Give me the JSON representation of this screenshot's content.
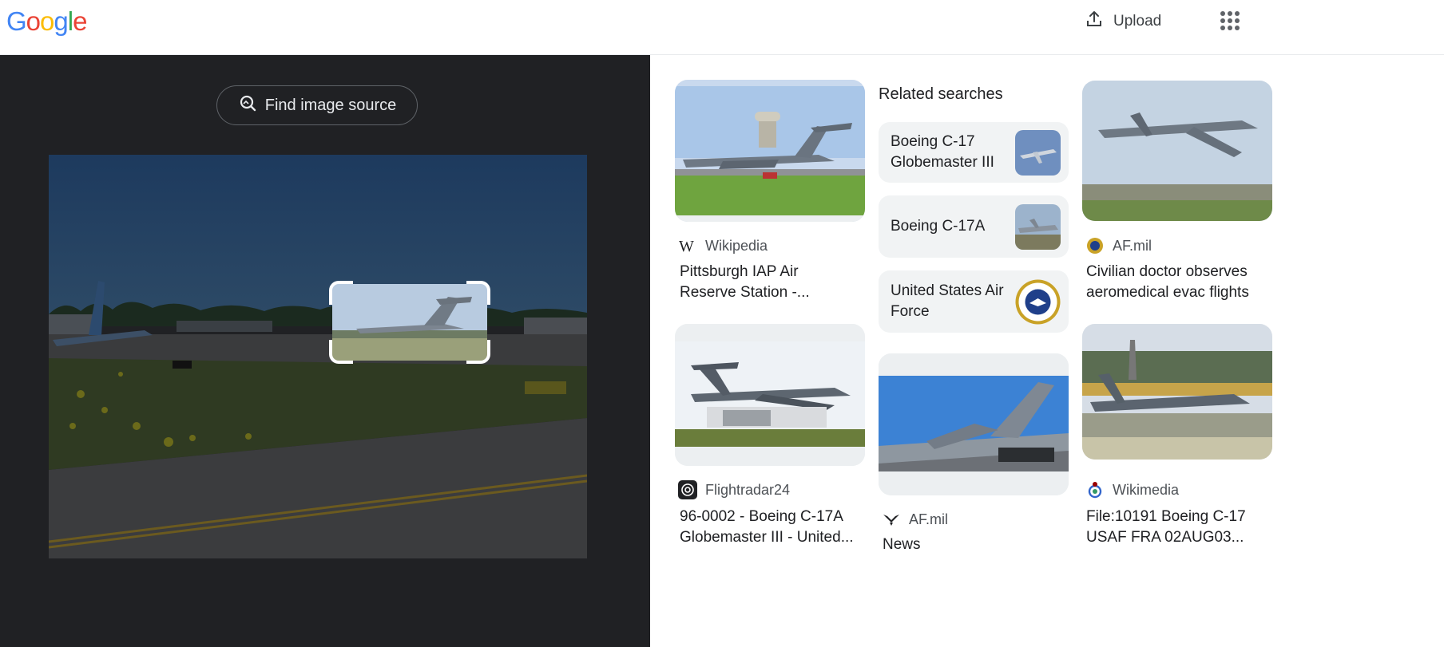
{
  "header": {
    "logo_letters": [
      "G",
      "o",
      "o",
      "g",
      "l",
      "e"
    ],
    "logo_colors": [
      "#4285F4",
      "#EA4335",
      "#FBBC05",
      "#4285F4",
      "#34A853",
      "#EA4335"
    ],
    "upload_label": "Upload",
    "upload_icon": "upload-icon",
    "apps_icon": "apps-grid-icon"
  },
  "lens": {
    "find_source_label": "Find image source",
    "find_source_icon": "image-search-icon"
  },
  "results": {
    "cards": [
      {
        "source": "Wikipedia",
        "source_icon": "wikipedia-icon",
        "title_line1": "Pittsburgh IAP Air",
        "title_line2": "Reserve Station -..."
      },
      {
        "source": "Flightradar24",
        "source_icon": "flightradar24-icon",
        "title_line1": "96-0002 - Boeing C-17A",
        "title_line2": "Globemaster III - United..."
      },
      {
        "source": "AF.mil",
        "source_icon": "af-mil-wings-icon",
        "title_line1": "News",
        "title_line2": ""
      },
      {
        "source": "AF.mil",
        "source_icon": "af-mil-seal-icon",
        "title_line1": "Civilian doctor observes",
        "title_line2": "aeromedical evac flights"
      },
      {
        "source": "Wikimedia",
        "source_icon": "wikimedia-icon",
        "title_line1": "File:10191 Boeing C-17",
        "title_line2": "USAF FRA 02AUG03..."
      }
    ],
    "related": {
      "heading": "Related searches",
      "items": [
        {
          "line1": "Boeing C-17",
          "line2": "Globemaster III"
        },
        {
          "line1": "Boeing C-17A",
          "line2": ""
        },
        {
          "line1": "United States Air",
          "line2": "Force"
        }
      ]
    }
  },
  "colors": {
    "dark_pane": "#202124",
    "chip_bg": "#f1f3f4",
    "text": "#202124",
    "secondary_text": "#4d5156"
  }
}
